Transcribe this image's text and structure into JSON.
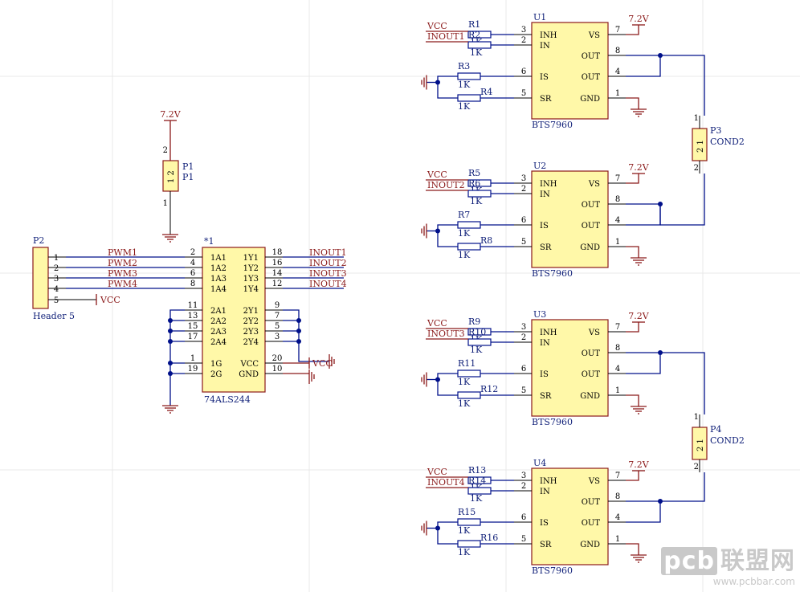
{
  "components": {
    "u1": {
      "ref": "U1",
      "part": "BTS7960"
    },
    "u2": {
      "ref": "U2",
      "part": "BTS7960"
    },
    "u3": {
      "ref": "U3",
      "part": "BTS7960"
    },
    "u4": {
      "ref": "U4",
      "part": "BTS7960"
    },
    "buffer": {
      "ref": "*1",
      "part": "74ALS244"
    },
    "p1": {
      "ref": "P1",
      "value": "P1"
    },
    "p2": {
      "ref": "P2",
      "value": "Header 5"
    },
    "p3": {
      "ref": "P3",
      "value": "COND2"
    },
    "p4": {
      "ref": "P4",
      "value": "COND2"
    }
  },
  "bts_pins": {
    "left": [
      {
        "num": "3",
        "name": "INH"
      },
      {
        "num": "2",
        "name": "IN"
      },
      {
        "num": "6",
        "name": "IS"
      },
      {
        "num": "5",
        "name": "SR"
      }
    ],
    "right": [
      {
        "num": "7",
        "name": "VS"
      },
      {
        "num": "8",
        "name": "OUT"
      },
      {
        "num": "4",
        "name": "OUT"
      },
      {
        "num": "1",
        "name": "GND"
      }
    ]
  },
  "buffer_pins": {
    "left": [
      {
        "num": "2",
        "name": "1A1"
      },
      {
        "num": "4",
        "name": "1A2"
      },
      {
        "num": "6",
        "name": "1A3"
      },
      {
        "num": "8",
        "name": "1A4"
      },
      {
        "num": "11",
        "name": "2A1"
      },
      {
        "num": "13",
        "name": "2A2"
      },
      {
        "num": "15",
        "name": "2A3"
      },
      {
        "num": "17",
        "name": "2A4"
      },
      {
        "num": "1",
        "name": "1G"
      },
      {
        "num": "19",
        "name": "2G"
      }
    ],
    "right": [
      {
        "num": "18",
        "name": "1Y1"
      },
      {
        "num": "16",
        "name": "1Y2"
      },
      {
        "num": "14",
        "name": "1Y3"
      },
      {
        "num": "12",
        "name": "1Y4"
      },
      {
        "num": "9",
        "name": "2Y1"
      },
      {
        "num": "7",
        "name": "2Y2"
      },
      {
        "num": "5",
        "name": "2Y3"
      },
      {
        "num": "3",
        "name": "2Y4"
      },
      {
        "num": "20",
        "name": "VCC"
      },
      {
        "num": "10",
        "name": "GND"
      }
    ]
  },
  "header_pins": [
    "1",
    "2",
    "3",
    "4",
    "5"
  ],
  "nets": {
    "pwm": [
      "PWM1",
      "PWM2",
      "PWM3",
      "PWM4"
    ],
    "inout": [
      "INOUT1",
      "INOUT2",
      "INOUT3",
      "INOUT4"
    ],
    "vcc": "VCC",
    "v72": "7.2V"
  },
  "resistors": {
    "refs": [
      "R1",
      "R2",
      "R3",
      "R4",
      "R5",
      "R6",
      "R7",
      "R8",
      "R9",
      "R10",
      "R11",
      "R12",
      "R13",
      "R14",
      "R15",
      "R16"
    ],
    "value": "1K"
  },
  "cond_pins": [
    "1",
    "2"
  ],
  "watermark": {
    "logo_box": "pcb",
    "logo_text": "联盟网",
    "url": "www.pcbbar.com"
  }
}
